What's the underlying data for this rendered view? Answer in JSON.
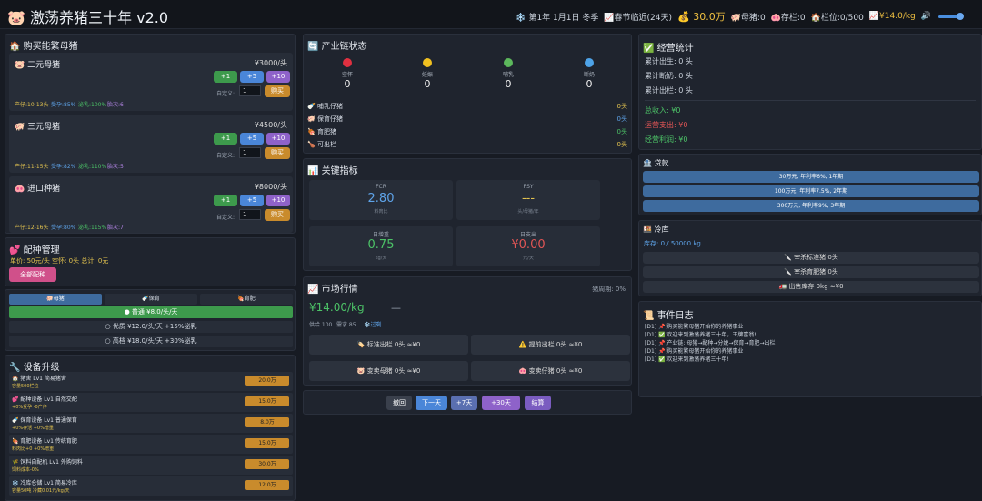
{
  "header": {
    "title": "🐷 激荡养猪三十年 v2.0",
    "date": "❄️ 第1年 1月1日 冬季",
    "festival": "📈春节临近(24天)",
    "cash": "💰 30.0万",
    "sows": "🐖母猪:0",
    "stock": "🐽存栏:0",
    "pens": "🏠栏位:0/500",
    "price": "📈¥14.0/kg",
    "vol_icon": "🔊"
  },
  "buy": {
    "title": "🏠 购买能繁母猪",
    "custom_label": "自定义:",
    "buy_label": "购买",
    "btn1": "+1",
    "btn5": "+5",
    "btn10": "+10",
    "items": [
      {
        "name": "🐷 二元母猪",
        "price": "¥3000/头",
        "qty": "1",
        "t1": "产仔:10-13头",
        "t2": "受孕:85%",
        "t3": "泌乳:100%",
        "t4": "胎次:6"
      },
      {
        "name": "🐖 三元母猪",
        "price": "¥4500/头",
        "qty": "1",
        "t1": "产仔:11-15头",
        "t2": "受孕:82%",
        "t3": "泌乳:110%",
        "t4": "胎次:5"
      },
      {
        "name": "🐽 进口种猪",
        "price": "¥8000/头",
        "qty": "1",
        "t1": "产仔:12-16头",
        "t2": "受孕:80%",
        "t3": "泌乳:115%",
        "t4": "胎次:7"
      }
    ]
  },
  "breed": {
    "title": "💕 配种管理",
    "info": "单价: 50元/头  空怀: 0头  总计: 0元",
    "all_btn": "全部配种"
  },
  "feed": {
    "tabs": [
      "🐖母猪",
      "🍼保育",
      "🍖育肥"
    ],
    "options": [
      "● 普通 ¥8.0/头/天",
      "○ 优质 ¥12.0/头/天 +15%泌乳",
      "○ 高档 ¥18.0/头/天 +30%泌乳"
    ]
  },
  "equip": {
    "title": "🔧 设备升级",
    "items": [
      {
        "name": "🏠 猪舍 Lv1 简易猪舍",
        "desc": "容量500栏位",
        "price": "20.0万"
      },
      {
        "name": "💕 配种设备 Lv1 自然交配",
        "desc": "+0%受孕 -0产仔",
        "price": "15.0万"
      },
      {
        "name": "🍼 保育设备 Lv1 普通保育",
        "desc": "+0%存活 +0%增重",
        "price": "8.0万"
      },
      {
        "name": "🍖 育肥设备 Lv1 传统育肥",
        "desc": "料肉比+0 +0%增重",
        "price": "15.0万"
      },
      {
        "name": "🌾 饲料自配机 Lv1 外购饲料",
        "desc": "饲料成本-0%",
        "price": "30.0万"
      },
      {
        "name": "❄️ 冷库仓储 Lv1 简易冷库",
        "desc": "容量50吨 冷藏0.01元/kg/天",
        "price": "12.0万"
      }
    ]
  },
  "chain": {
    "title": "🔄 产业链状态",
    "stages": [
      {
        "label": "空怀",
        "value": "0",
        "color": "#e03040"
      },
      {
        "label": "妊娠",
        "value": "0",
        "color": "#f0c020"
      },
      {
        "label": "哺乳",
        "value": "0",
        "color": "#5cb85c"
      },
      {
        "label": "断奶",
        "value": "0",
        "color": "#4ea3e8"
      }
    ],
    "rows": [
      {
        "label": "🍼 哺乳仔猪",
        "value": "0头"
      },
      {
        "label": "🐖 保育仔猪",
        "value": "0头"
      },
      {
        "label": "🍖 育肥猪",
        "value": "0头"
      },
      {
        "label": "🍗 可出栏",
        "value": "0头"
      }
    ]
  },
  "kpi": {
    "title": "📊 关键指标",
    "cards": [
      {
        "label": "FCR",
        "value": "2.80",
        "unit": "料肉比"
      },
      {
        "label": "PSY",
        "value": "---",
        "unit": "头/母猪/年"
      },
      {
        "label": "日增重",
        "value": "0.75",
        "unit": "kg/天"
      },
      {
        "label": "日支出",
        "value": "¥0.00",
        "unit": "元/天"
      }
    ]
  },
  "market": {
    "title": "📈 市场行情",
    "cycle": "猪周期: 0%",
    "price": "¥14.00/kg",
    "trend": "—",
    "sub1": "供给 100",
    "sub2": "需求 85",
    "sub3": "❄️过剩",
    "actions": [
      "🏷️ 标准出栏 0头 ≈¥0",
      "⚠️ 提前出栏 0头 ≈¥0",
      "🐷 变卖母猪 0头 ≈¥0",
      "🐽 变卖仔猪 0头 ≈¥0"
    ]
  },
  "controls": {
    "undo": "撤回",
    "next": "下一天",
    "d7": "+7天",
    "d30": "+30天",
    "settle": "结算"
  },
  "stats": {
    "title": "✅ 经营统计",
    "births": "累计出生: 0 头",
    "weaned": "累计断奶: 0 头",
    "sold": "累计出栏: 0 头",
    "income": "总收入: ¥0",
    "cost": "运营支出: ¥0",
    "profit": "经营利润: ¥0"
  },
  "loan": {
    "title": "🏦 贷款",
    "options": [
      "30万元, 年利率6%, 1年期",
      "100万元, 年利率7.5%, 2年期",
      "300万元, 年利率9%, 3年期"
    ]
  },
  "cold": {
    "title": "🍱 冷库",
    "storage": "库存: 0 / 50000 kg",
    "b1": "🔪 宰杀标准猪 0头",
    "b2": "🔪 宰杀育肥猪 0头",
    "b3": "🚛 出售库存 0kg ≈¥0"
  },
  "events": {
    "title": "📜 事件日志",
    "lines": [
      "[D1] 📌 购买能繁母猪开始你的养猪事业",
      "[D1] ✅ 欢迎来到激荡养猪三十年，王牌富翁!",
      "[D1] 📌 产业链: 母猪→配种→分娩→保育→育肥→出栏",
      "[D1] 📌 购买能繁母猪开始你的养猪事业",
      "[D1] ✅ 欢迎来到激荡养猪三十年!"
    ]
  },
  "colors": {
    "accent": "#4a86d8",
    "green": "#3d9a4c",
    "purple": "#8e62c9",
    "orange": "#c98b2c",
    "gold": "#f0c040"
  }
}
